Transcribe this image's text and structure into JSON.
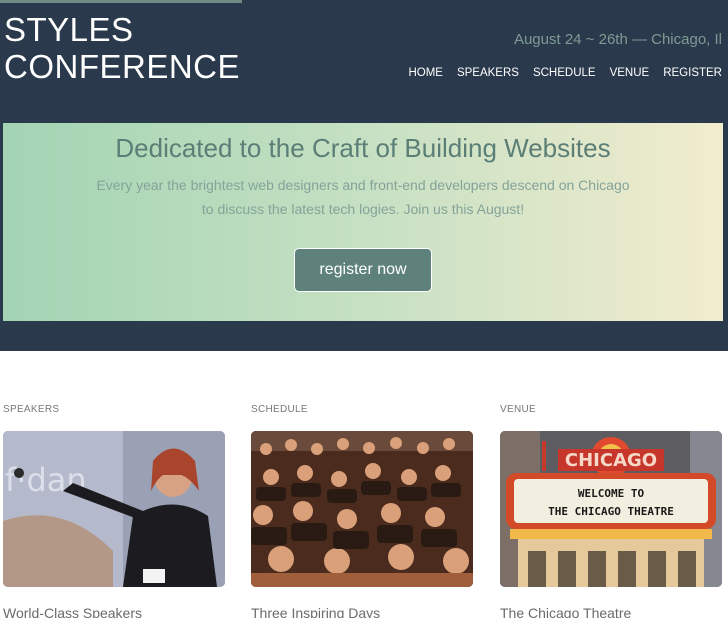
{
  "header": {
    "logo_line1": "STYLES",
    "logo_line2": "CONFERENCE",
    "event_info": "August 24 ~ 26th — Chicago, Il",
    "nav": [
      "HOME",
      "SPEAKERS",
      "SCHEDULE",
      "VENUE",
      "REGISTER"
    ]
  },
  "hero": {
    "title": "Dedicated to the Craft of Building Websites",
    "text_line1": "Every year the brightest web designers and front-end developers descend on Chicago",
    "text_line2": "to discuss the latest tech logies. Join us this August!",
    "button_label": "register now"
  },
  "teasers": [
    {
      "label": "SPEAKERS",
      "title": "World-Class Speakers"
    },
    {
      "label": "SCHEDULE",
      "title": "Three Inspiring Days"
    },
    {
      "label": "VENUE",
      "title": "The Chicago Theatre"
    }
  ],
  "venue_sign": {
    "marquee_name": "CHICAGO",
    "marquee_line1": "WELCOME TO",
    "marquee_line2": "THE CHICAGO THEATRE"
  },
  "colors": {
    "header_bg": "#2a3a4c",
    "accent": "#5e827b",
    "gradient_start": "#a2d4b3",
    "gradient_end": "#f2ecce"
  }
}
